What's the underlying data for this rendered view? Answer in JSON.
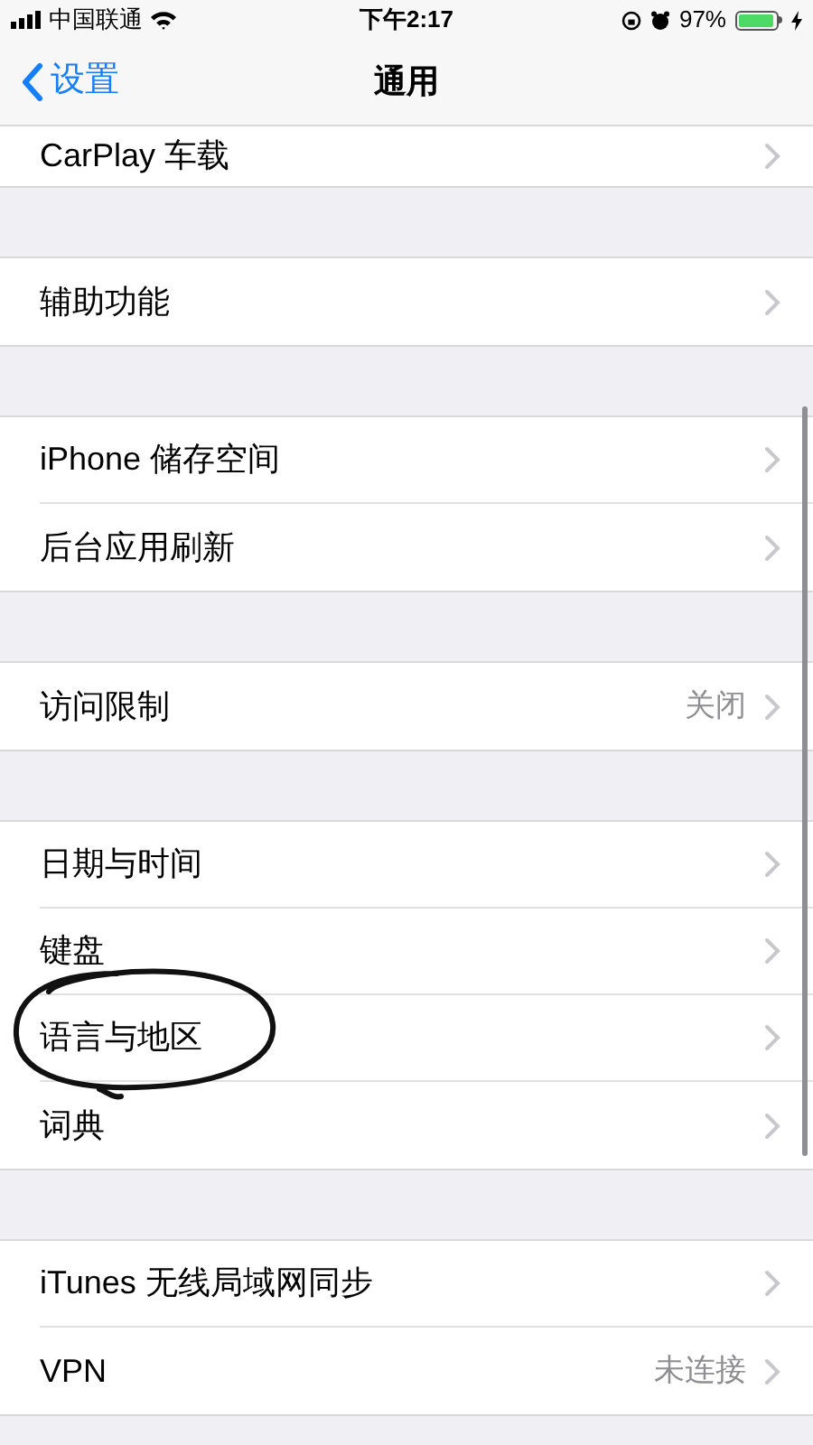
{
  "status_bar": {
    "carrier": "中国联通",
    "time": "下午2:17",
    "battery_percent": "97%",
    "battery": {
      "level": 0.97
    }
  },
  "nav": {
    "back": "设置",
    "title": "通用"
  },
  "groups": [
    {
      "rows": [
        {
          "label": "CarPlay 车载"
        }
      ]
    },
    {
      "rows": [
        {
          "label": "辅助功能"
        }
      ]
    },
    {
      "rows": [
        {
          "label": "iPhone 储存空间"
        },
        {
          "label": "后台应用刷新"
        }
      ]
    },
    {
      "rows": [
        {
          "label": "访问限制",
          "detail": "关闭"
        }
      ]
    },
    {
      "rows": [
        {
          "label": "日期与时间"
        },
        {
          "label": "键盘"
        },
        {
          "label": "语言与地区",
          "circled": true
        },
        {
          "label": "词典"
        }
      ]
    },
    {
      "rows": [
        {
          "label": "iTunes 无线局域网同步"
        },
        {
          "label": "VPN",
          "detail": "未连接"
        }
      ]
    }
  ]
}
